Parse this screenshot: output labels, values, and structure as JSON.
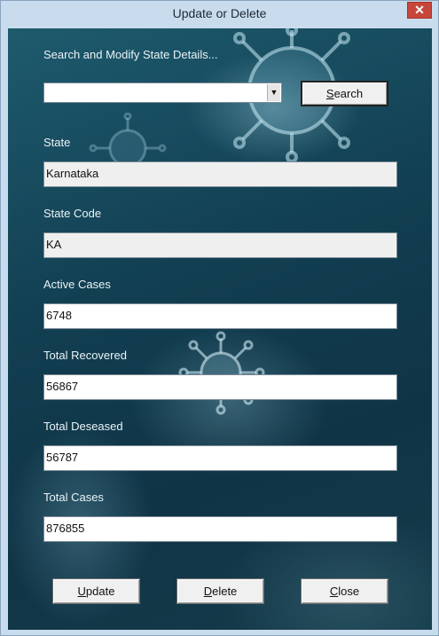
{
  "window": {
    "title": "Update or Delete",
    "close_glyph": "✕"
  },
  "search": {
    "label": "Search and Modify State Details...",
    "combo_value": "",
    "button_first": "S",
    "button_rest": "earch"
  },
  "fields": {
    "state": {
      "label": "State",
      "value": "Karnataka"
    },
    "state_code": {
      "label": "State Code",
      "value": "KA"
    },
    "active_cases": {
      "label": "Active Cases",
      "value": "6748"
    },
    "total_recovered": {
      "label": "Total Recovered",
      "value": "56867"
    },
    "total_deseased": {
      "label": "Total Deseased",
      "value": "56787"
    },
    "total_cases": {
      "label": "Total Cases",
      "value": "876855"
    }
  },
  "buttons": {
    "update_first": "U",
    "update_rest": "pdate",
    "delete_first": "D",
    "delete_rest": "elete",
    "close_first": "C",
    "close_rest": "lose"
  },
  "icons": {
    "close": "close-icon",
    "dropdown": "chevron-down-icon"
  },
  "colors": {
    "background_dark": "#123f52",
    "close_button": "#c7463a"
  }
}
